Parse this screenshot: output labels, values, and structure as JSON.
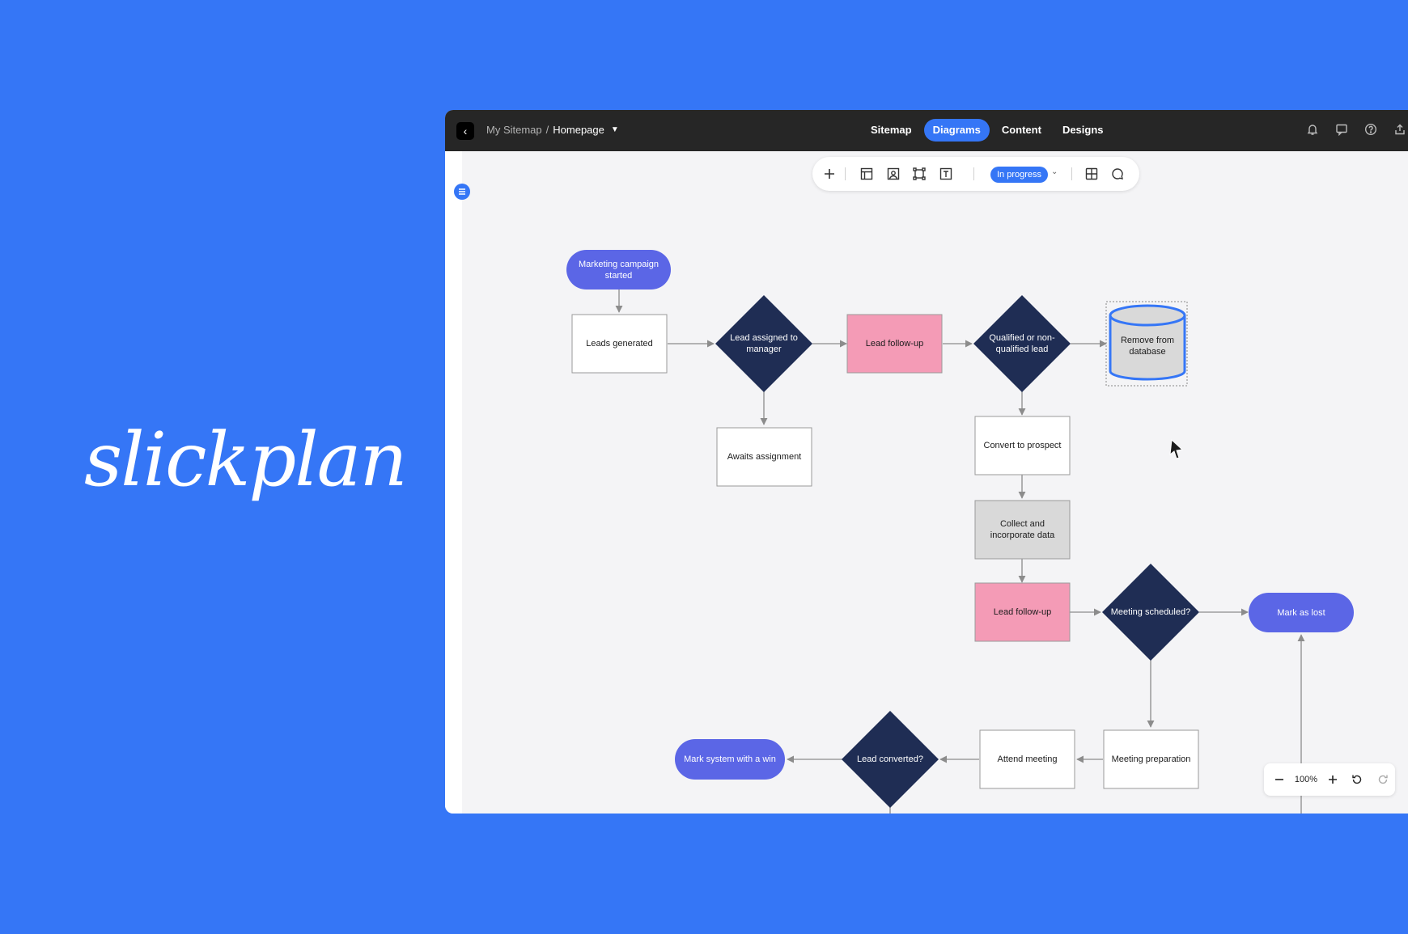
{
  "brand": {
    "logo_text": "slickplan"
  },
  "header": {
    "breadcrumb_root": "My Sitemap",
    "breadcrumb_sep": "/",
    "breadcrumb_current": "Homepage",
    "tabs": [
      {
        "label": "Sitemap",
        "active": false
      },
      {
        "label": "Diagrams",
        "active": true
      },
      {
        "label": "Content",
        "active": false
      },
      {
        "label": "Designs",
        "active": false
      }
    ],
    "icons": [
      "bell-icon",
      "comment-icon",
      "help-icon",
      "share-icon"
    ]
  },
  "toolbar": {
    "icons": [
      "add-icon",
      "layout-icon",
      "image-block-icon",
      "frame-icon",
      "text-icon",
      "grid-icon",
      "comment-icon"
    ],
    "status": "In progress"
  },
  "diagram": {
    "nodes": {
      "n1": "Marketing campaign started",
      "n2": "Leads generated",
      "n3": "Lead assigned to manager",
      "n4": "Awaits assignment",
      "n5": "Lead follow-up",
      "n6": "Qualified or non-qualified lead",
      "n7": "Remove from database",
      "n8": "Convert to prospect",
      "n9": "Collect and incorporate data",
      "n10": "Lead follow-up",
      "n11": "Meeting scheduled?",
      "n12": "Mark as lost",
      "n13": "Meeting preparation",
      "n14": "Attend meeting",
      "n15": "Lead converted?",
      "n16": "Mark system with a win"
    },
    "colors": {
      "terminal": "#5b66e6",
      "decision": "#1f2d54",
      "highlight": "#f49bb6",
      "data": "#d9d9d9",
      "process": "#ffffff",
      "connector": "#8c8c8c"
    }
  },
  "zoom": {
    "level": "100%"
  }
}
